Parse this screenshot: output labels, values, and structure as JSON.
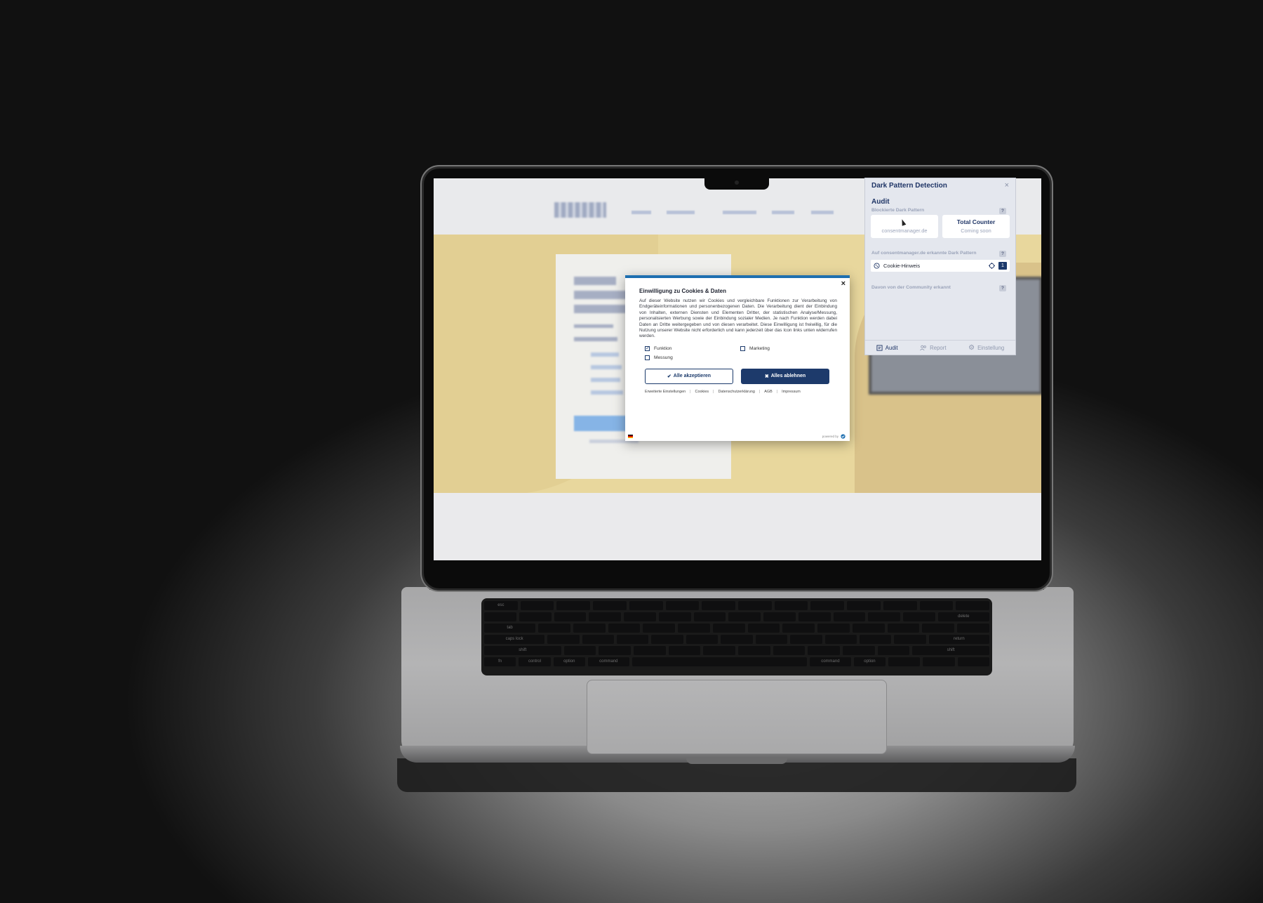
{
  "cookie_banner": {
    "title": "Einwilligung zu Cookies & Daten",
    "body": "Auf dieser Website nutzen wir Cookies und vergleichbare Funktionen zur Verarbeitung von Endgeräteinformationen und personenbezogenen Daten. Die Verarbeitung dient der Einbindung von Inhalten, externen Diensten und Elementen Dritter, der statistischen Analyse/Messung, personalisierten Werbung sowie der Einbindung sozialer Medien. Je nach Funktion werden dabei Daten an Dritte weitergegeben und von diesen verarbeitet. Diese Einwilligung ist freiwillig, für die Nutzung unserer Website nicht erforderlich und kann jederzeit über das Icon links unten widerrufen werden.",
    "close": "×",
    "checkboxes": [
      {
        "label": "Funktion",
        "checked": true
      },
      {
        "label": "Marketing",
        "checked": false
      },
      {
        "label": "Messung",
        "checked": false
      }
    ],
    "accept_label": "Alle akzeptieren",
    "reject_label": "Alles ablehnen",
    "links": [
      "Erweiterte Einstellungen",
      "Cookies",
      "Datenschutzerklärung",
      "AGB",
      "Impressum"
    ],
    "powered_by": "powered by"
  },
  "extension": {
    "title": "Dark Pattern Detection",
    "close": "×",
    "section": "Audit",
    "blocked_label": "Blockierte Dark Pattern",
    "help": "?",
    "stat_left": {
      "title": "",
      "subtitle": "consentmanager.de"
    },
    "stat_right": {
      "title": "Total Counter",
      "subtitle": "Coming soon"
    },
    "detected_label": "Auf consentmanager.de erkannte Dark Pattern",
    "detected_item": {
      "label": "Cookie-Hinweis",
      "count": "1"
    },
    "community_label": "Davon von der Community erkannt",
    "footer": [
      {
        "label": "Audit",
        "icon": "audit-icon",
        "active": true
      },
      {
        "label": "Report",
        "icon": "users-icon",
        "active": false
      },
      {
        "label": "Einstellung",
        "icon": "gear-icon",
        "active": false
      }
    ]
  },
  "keyboard": {
    "labels": [
      "esc",
      "tab",
      "caps lock",
      "shift",
      "fn",
      "control",
      "option",
      "command",
      "command",
      "option",
      "delete",
      "return",
      "shift"
    ]
  },
  "colors": {
    "accent": "#1d3a6b",
    "extension_bg": "#e4e7ee",
    "hero_bg": "#e8d79d"
  }
}
